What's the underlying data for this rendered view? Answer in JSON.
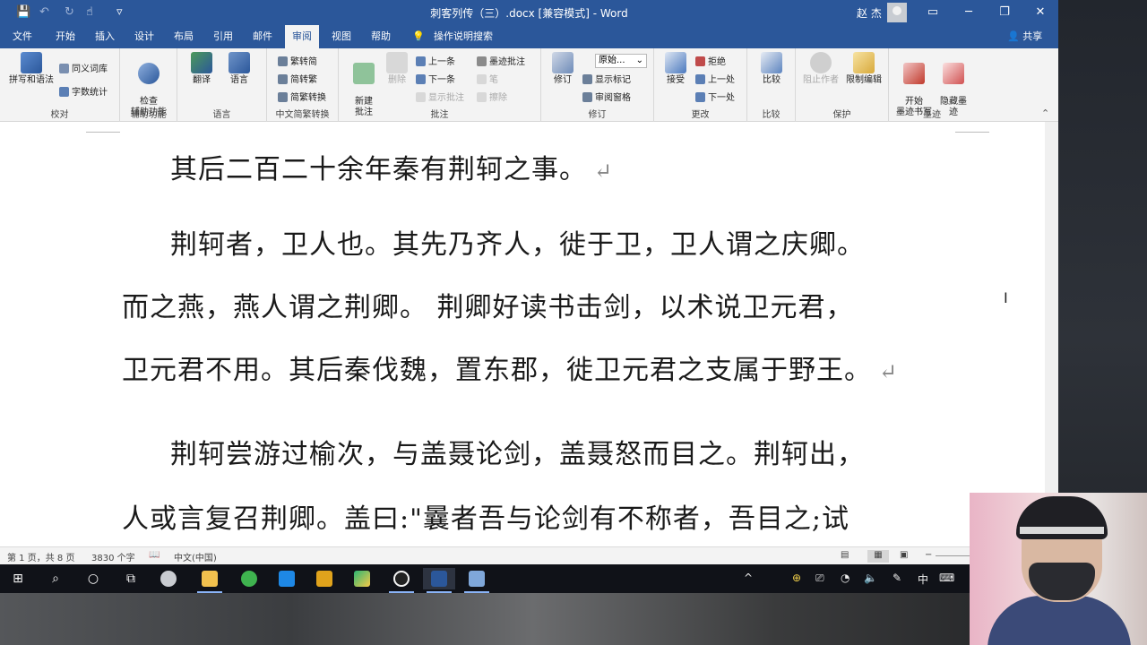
{
  "window": {
    "title": "刺客列传（三）.docx [兼容模式] - Word",
    "user": "赵 杰",
    "minimize": "─",
    "restore": "❐",
    "close": "✕",
    "ribbon_display": "▭"
  },
  "qat": {
    "save": "💾",
    "undo": "↶",
    "redo": "↻",
    "touch": "☝",
    "more": "▿"
  },
  "menu": {
    "tabs": [
      "文件",
      "开始",
      "插入",
      "设计",
      "布局",
      "引用",
      "邮件",
      "审阅",
      "视图",
      "帮助"
    ],
    "active": "审阅",
    "tell_me": "操作说明搜索",
    "share": "共享"
  },
  "ribbon": {
    "proofing": {
      "spell": "拼写和语法",
      "thesaurus": "同义词库",
      "wordcount": "字数统计",
      "label": "校对"
    },
    "accessibility": {
      "check": "检查\n辅助功能",
      "label": "辅助功能"
    },
    "language": {
      "translate": "翻译",
      "language": "语言",
      "label": "语言"
    },
    "chinese": {
      "to_simp": "繁转简",
      "to_trad": "简转繁",
      "convert": "简繁转换",
      "label": "中文简繁转换"
    },
    "comments": {
      "new": "新建\n批注",
      "delete": "删除",
      "prev": "上一条",
      "next": "下一条",
      "show": "显示批注",
      "ink": "墨迹批注",
      "pen": "笔",
      "erase": "擦除",
      "label": "批注"
    },
    "tracking": {
      "track": "修订",
      "markup_value": "原始...",
      "show_markup": "显示标记",
      "pane": "审阅窗格",
      "label": "修订"
    },
    "changes": {
      "accept": "接受",
      "reject": "拒绝",
      "prev": "上一处",
      "next": "下一处",
      "label": "更改"
    },
    "compare": {
      "compare": "比较",
      "label": "比较"
    },
    "protect": {
      "block": "阻止作者",
      "restrict": "限制编辑",
      "label": "保护"
    },
    "ink": {
      "start": "开始\n墨迹书写",
      "hide": "隐藏墨\n迹",
      "label": "墨迹"
    }
  },
  "document": {
    "lines": [
      "其后二百二十余年秦有荆轲之事。",
      "荆轲者，卫人也。其先乃齐人，徙于卫，卫人谓之庆卿。",
      "而之燕，燕人谓之荆卿。 荆卿好读书击剑，以术说卫元君，",
      "卫元君不用。其后秦伐魏，置东郡，徙卫元君之支属于野王。",
      "荆轲尝游过榆次，与盖聂论剑，盖聂怒而目之。荆轲出，",
      "人或言复召荆卿。盖曰:\"曩者吾与论剑有不称者，吾目之;试"
    ],
    "para_mark": "↵"
  },
  "status": {
    "page": "第 1 页，共 8 页",
    "words": "3830 个字",
    "language": "中文(中国)"
  },
  "taskbar": {
    "tray_ime": "中",
    "tray_more": "^"
  },
  "colors": {
    "word_blue": "#2b579a",
    "ribbon_bg": "#f3f3f3"
  }
}
